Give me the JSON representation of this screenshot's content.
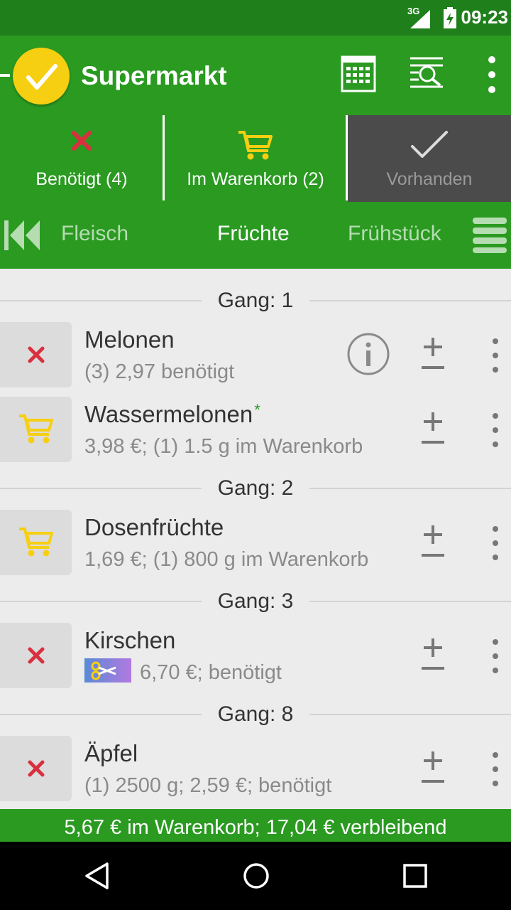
{
  "status": {
    "network": "3G",
    "time": "09:23"
  },
  "appbar": {
    "title": "Supermarkt",
    "icons": [
      "calendar-grid-icon",
      "search-list-icon",
      "overflow-menu-icon"
    ]
  },
  "tabs": [
    {
      "label": "Benötigt (4)",
      "icon": "x-icon"
    },
    {
      "label": "Im Warenkorb (2)",
      "icon": "cart-icon"
    },
    {
      "label": "Vorhanden",
      "icon": "check-icon",
      "selected": true
    }
  ],
  "categories": {
    "prev": "Fleisch",
    "current": "Früchte",
    "next": "Frühstück"
  },
  "sections": [
    {
      "label": "Gang: 1"
    },
    {
      "label": "Gang: 2"
    },
    {
      "label": "Gang: 3"
    },
    {
      "label": "Gang: 8"
    }
  ],
  "items": [
    {
      "name": "Melonen",
      "detail": "(3) 2,97 benötigt",
      "state": "needed"
    },
    {
      "name": "Wassermelonen",
      "star": "*",
      "detail": "3,98 €; (1) 1.5 g im Warenkorb",
      "state": "cart"
    },
    {
      "name": "Dosenfrüchte",
      "detail": "1,69 €; (1) 800 g im Warenkorb",
      "state": "cart"
    },
    {
      "name": "Kirschen",
      "detail": "6,70 €; benötigt",
      "state": "needed"
    },
    {
      "name": "Äpfel",
      "detail": "(1) 2500 g; 2,59 €; benötigt",
      "state": "needed"
    }
  ],
  "footer": "5,67 € im Warenkorb; 17,04 € verbleibend",
  "colors": {
    "primary": "#2a9a21",
    "statusbar": "#1f7f1a",
    "accent": "#f6cf12",
    "cross": "#d9303f"
  }
}
